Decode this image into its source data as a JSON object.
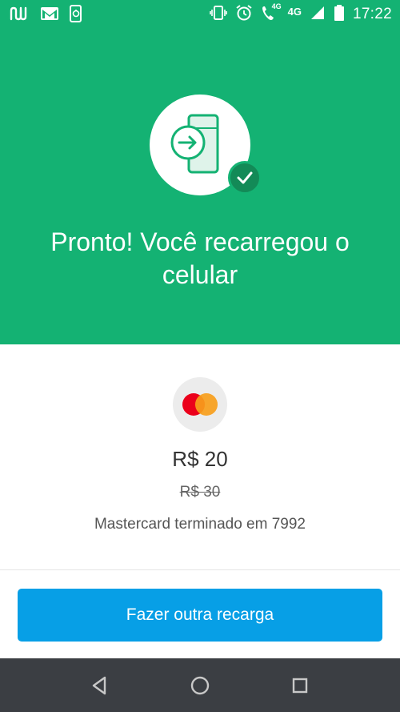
{
  "status_bar": {
    "time": "17:22",
    "network_small": "4G",
    "network": "4G",
    "left_icons": [
      "nubank-icon",
      "gmail-icon",
      "phone-recharge-icon"
    ],
    "right_icons": [
      "vibrate-icon",
      "alarm-icon",
      "wifi-calling-icon",
      "signal-icon",
      "battery-icon"
    ]
  },
  "hero": {
    "title": "Pronto! Você recarregou o celular",
    "icon": "phone-recharge-icon",
    "badge_icon": "check-icon"
  },
  "payment": {
    "card_icon": "mastercard-icon",
    "amount": "R$ 20",
    "old_amount": "R$ 30",
    "card_description": "Mastercard terminado em 7992"
  },
  "actions": {
    "primary_label": "Fazer outra recarga"
  },
  "nav": {
    "icons": [
      "back-icon",
      "home-icon",
      "recents-icon"
    ]
  },
  "colors": {
    "hero_green": "#14b273",
    "badge_green": "#138a57",
    "button_blue": "#079fe6",
    "nav_dark": "#3b3e43"
  }
}
